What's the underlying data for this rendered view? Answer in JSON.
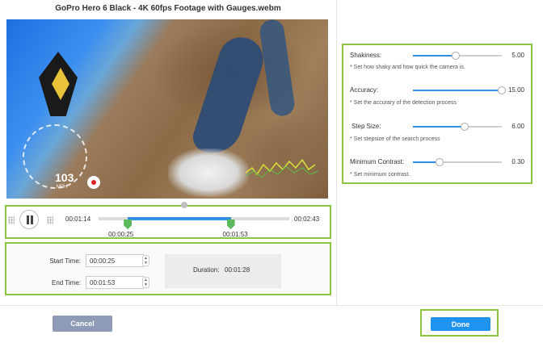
{
  "window": {
    "title": "GoPro Hero 6 Black - 4K 60fps Footage with Gauges.webm"
  },
  "video": {
    "speed_readout": "103",
    "speed_unit": "MPH"
  },
  "playback": {
    "current_time": "00:01:14",
    "total_time": "00:02:43",
    "start_marker": "00:00:25",
    "end_marker": "00:01:53",
    "selection_start_fraction": 0.153,
    "selection_end_fraction": 0.693
  },
  "trim": {
    "start_label": "Start Time:",
    "start_value": "00:00:25",
    "end_label": "End Time:",
    "end_value": "00:01:53",
    "duration_label": "Duration:",
    "duration_value": "00:01:28"
  },
  "settings": [
    {
      "label": "Shakiness:",
      "value": "5.00",
      "fraction": 0.48,
      "note": "* Set how shaky and how quick the camera is."
    },
    {
      "label": "Accuracy:",
      "value": "15.00",
      "fraction": 1.0,
      "note": "* Set the accurary of the detection process"
    },
    {
      "label": "Step Size:",
      "value": "6.00",
      "fraction": 0.58,
      "note": "* Set stepsize of the search process"
    },
    {
      "label": "Minimum Contrast:",
      "value": "0.30",
      "fraction": 0.3,
      "note": "* Set minimum contrast."
    }
  ],
  "footer": {
    "cancel_label": "Cancel",
    "done_label": "Done"
  },
  "colors": {
    "accent": "#2f8fe0",
    "highlight_border": "#8cc63f",
    "marker": "#5cb85c",
    "done": "#1f93f0",
    "cancel": "#8e9bb6"
  }
}
